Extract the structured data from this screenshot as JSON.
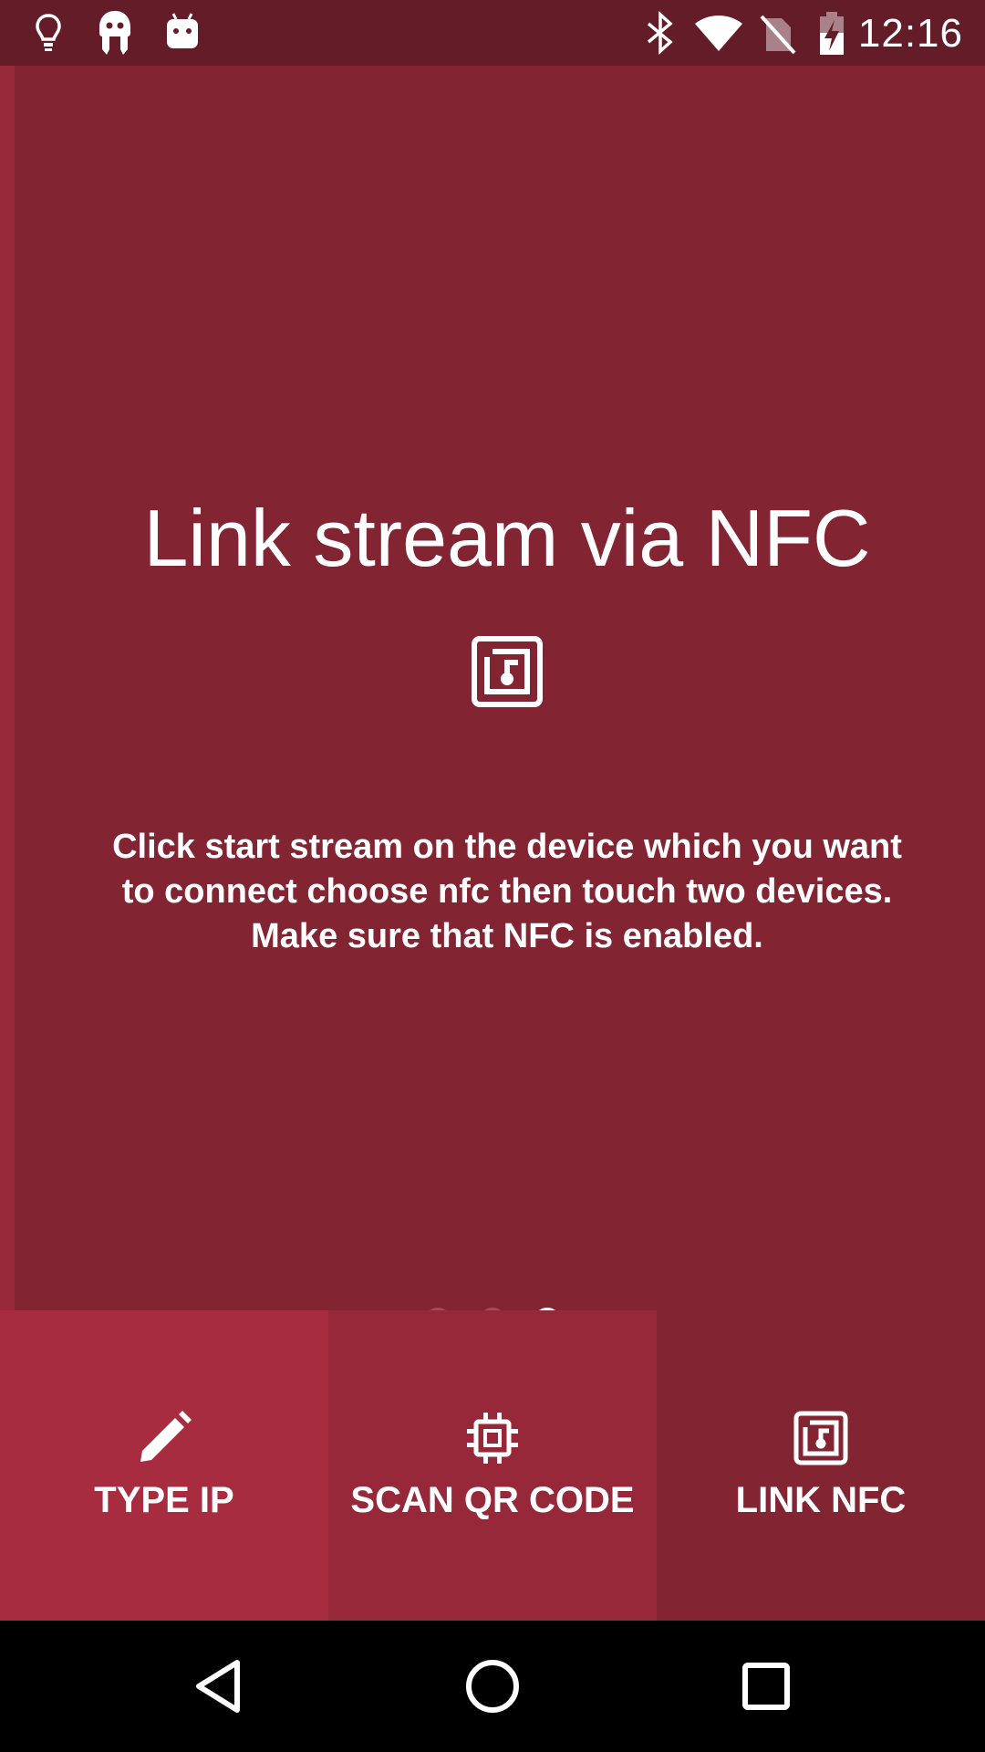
{
  "status_bar": {
    "time": "12:16",
    "left_icons": [
      "lightbulb-icon",
      "ghost-app-icon",
      "android-icon"
    ],
    "right_icons": [
      "bluetooth-icon",
      "wifi-icon",
      "no-sim-icon",
      "battery-charging-icon"
    ]
  },
  "slide": {
    "title": "Link stream via NFC",
    "icon": "nfc-icon",
    "description": "Click start stream on the device which you want to connect choose nfc then touch two devices. Make sure that NFC is enabled.",
    "page_count": 3,
    "current_page": 3
  },
  "actions": [
    {
      "label": "TYPE IP",
      "icon": "pencil-icon",
      "color": "#a82c3f"
    },
    {
      "label": "SCAN QR CODE",
      "icon": "chip-icon",
      "color": "#96283a"
    },
    {
      "label": "LINK NFC",
      "icon": "nfc-icon",
      "color": "#832432"
    }
  ],
  "colors": {
    "status_bar": "#631c28",
    "background": "#832432",
    "accent": "#a82c3f"
  },
  "nav_bar": {
    "buttons": [
      "back-icon",
      "home-icon",
      "recents-icon"
    ]
  }
}
